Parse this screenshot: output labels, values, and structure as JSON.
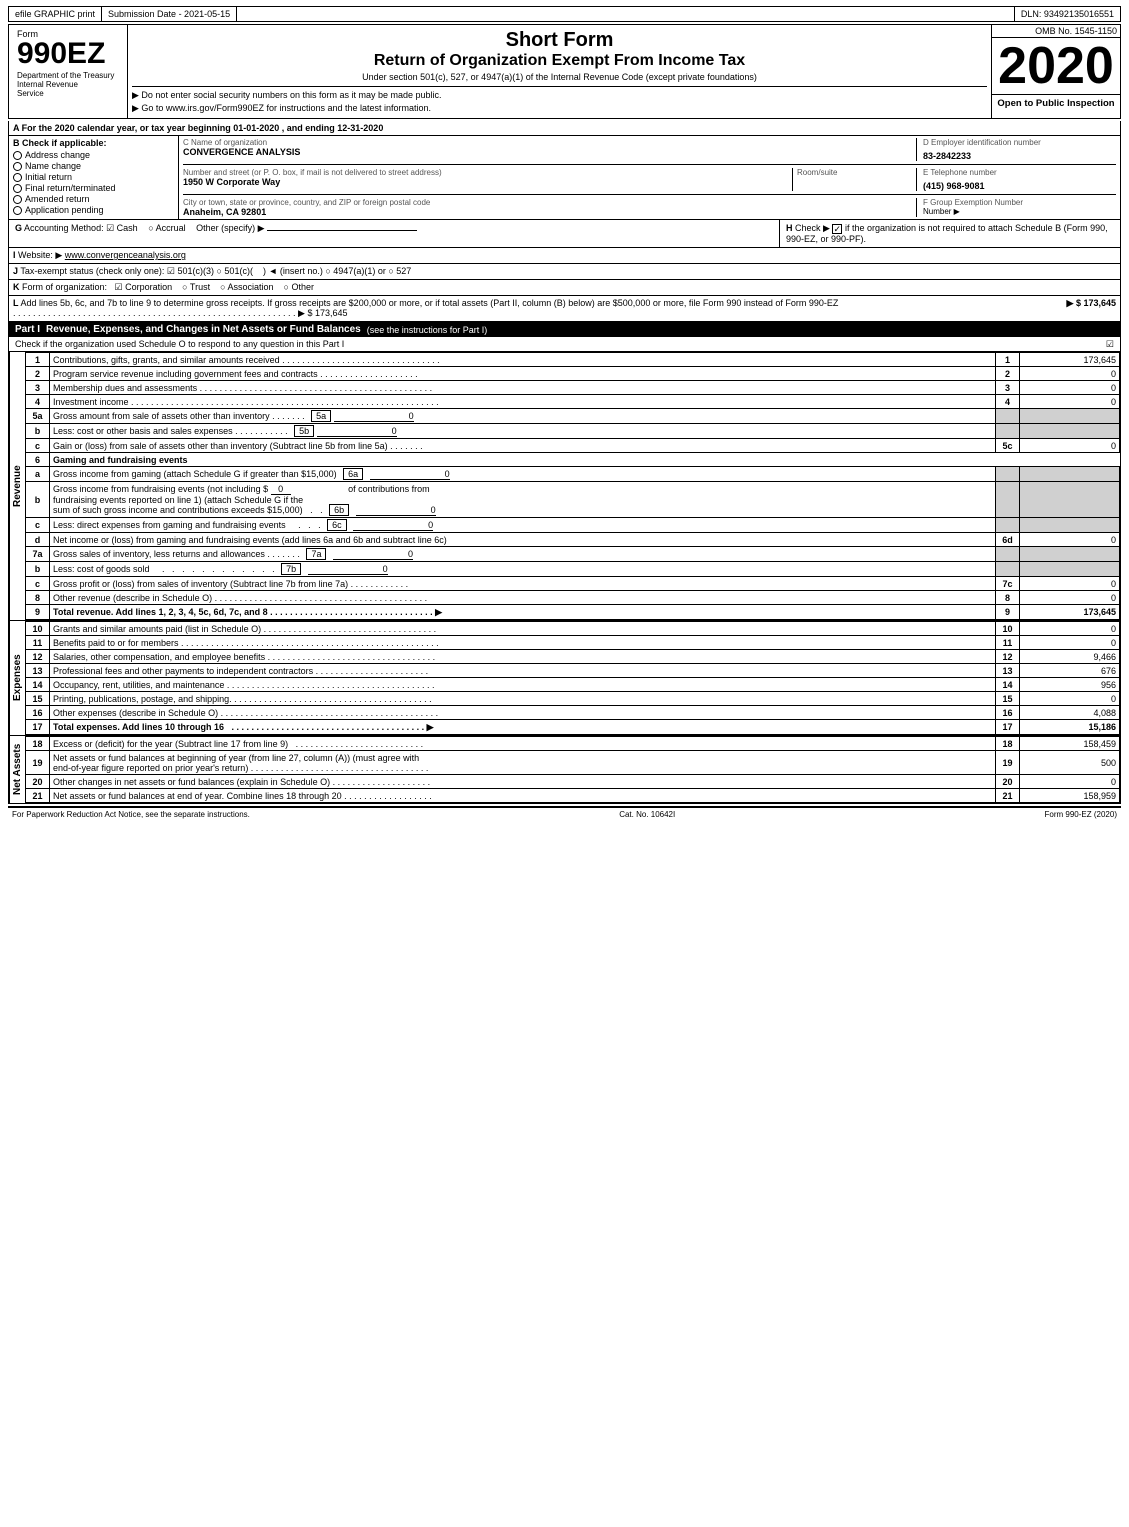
{
  "topbar": {
    "efile": "efile GRAPHIC print",
    "submission": "Submission Date - 2021-05-15",
    "dln": "DLN: 93492135016551"
  },
  "header": {
    "form_label": "Form",
    "form_number": "990EZ",
    "short_form": "Short Form",
    "return_title": "Return of Organization Exempt From Income Tax",
    "under_section": "Under section 501(c), 527, or 4947(a)(1) of the Internal Revenue Code (except private foundations)",
    "no_ssn": "▶ Do not enter social security numbers on this form as it may be made public.",
    "goto": "▶ Go to www.irs.gov/Form990EZ for instructions and the latest information.",
    "year": "2020",
    "open_public": "Open to Public Inspection",
    "omb": "OMB No. 1545-1150",
    "dept": "Department of the Treasury",
    "int_rev": "Internal Revenue",
    "service": "Service"
  },
  "section_a": {
    "text": "A  For the 2020 calendar year, or tax year beginning 01-01-2020 , and ending 12-31-2020"
  },
  "section_b": {
    "label": "B  Check if applicable:",
    "checkboxes": [
      {
        "label": "Address change",
        "checked": false
      },
      {
        "label": "Name change",
        "checked": false
      },
      {
        "label": "Initial return",
        "checked": false
      },
      {
        "label": "Final return/terminated",
        "checked": false
      },
      {
        "label": "Amended return",
        "checked": false
      },
      {
        "label": "Application pending",
        "checked": false
      }
    ],
    "c_label": "C Name of organization",
    "org_name": "CONVERGENCE ANALYSIS",
    "street_label": "Number and street (or P. O. box, if mail is not delivered to street address)",
    "street": "1950 W Corporate Way",
    "room_label": "Room/suite",
    "room": "",
    "city_label": "City or town, state or province, country, and ZIP or foreign postal code",
    "city": "Anaheim, CA  92801",
    "d_label": "D Employer identification number",
    "ein": "83-2842233",
    "e_label": "E Telephone number",
    "phone": "(415) 968-9081",
    "f_label": "F Group Exemption Number",
    "group_num": ""
  },
  "section_g": {
    "label": "G Accounting Method:",
    "cash_label": "☑ Cash",
    "cash_checked": true,
    "accrual_label": "○ Accrual",
    "other_label": "Other (specify) ▶",
    "h_label": "H  Check ▶",
    "h_checked": true,
    "h_text": "if the organization is not required to attach Schedule B (Form 990, 990-EZ, or 990-PF)."
  },
  "section_i": {
    "label": "I Website: ▶",
    "website": "www.convergenceanalysis.org"
  },
  "section_j": {
    "label": "J Tax-exempt status (check only one):",
    "options": [
      {
        "label": "501(c)(3)",
        "checked": true
      },
      {
        "label": "501(c)(",
        "checked": false
      },
      {
        "label": ") ◄ (insert no.)",
        "checked": false
      },
      {
        "label": "4947(a)(1) or",
        "checked": false
      },
      {
        "label": "527",
        "checked": false
      }
    ]
  },
  "section_k": {
    "label": "K Form of organization:",
    "options": [
      {
        "label": "Corporation",
        "checked": true
      },
      {
        "label": "Trust",
        "checked": false
      },
      {
        "label": "Association",
        "checked": false
      },
      {
        "label": "Other",
        "checked": false
      }
    ]
  },
  "section_l": {
    "text": "L Add lines 5b, 6c, and 7b to line 9 to determine gross receipts. If gross receipts are $200,000 or more, or if total assets (Part II, column (B) below) are $500,000 or more, file Form 990 instead of Form 990-EZ",
    "value": "▶ $ 173,645"
  },
  "part1": {
    "title": "Part I",
    "description": "Revenue, Expenses, and Changes in Net Assets or Fund Balances",
    "see_instructions": "(see the instructions for Part I)",
    "check_text": "Check if the organization used Schedule O to respond to any question in this Part I",
    "lines": [
      {
        "num": "1",
        "desc": "Contributions, gifts, grants, and similar amounts received",
        "dots": true,
        "ref": "1",
        "value": "173,645"
      },
      {
        "num": "2",
        "desc": "Program service revenue including government fees and contracts",
        "dots": true,
        "ref": "2",
        "value": "0"
      },
      {
        "num": "3",
        "desc": "Membership dues and assessments",
        "dots": true,
        "ref": "3",
        "value": "0"
      },
      {
        "num": "4",
        "desc": "Investment income",
        "dots": true,
        "ref": "4",
        "value": "0"
      },
      {
        "num": "5a",
        "desc": "Gross amount from sale of assets other than inventory",
        "dots": false,
        "ref": "5a",
        "value": "0",
        "inline_ref": true
      },
      {
        "num": "b",
        "desc": "Less: cost or other basis and sales expenses",
        "dots": false,
        "ref": "5b",
        "value": "0",
        "inline_ref": true
      },
      {
        "num": "c",
        "desc": "Gain or (loss) from sale of assets other than inventory (Subtract line 5b from line 5a)",
        "dots": true,
        "ref": "5c",
        "value": "0"
      },
      {
        "num": "6",
        "desc": "Gaming and fundraising events",
        "dots": false,
        "ref": "",
        "value": "",
        "header": true
      },
      {
        "num": "a",
        "desc": "Gross income from gaming (attach Schedule G if greater than $15,000)",
        "dots": false,
        "ref": "6a",
        "value": "0",
        "inline_ref": true
      },
      {
        "num": "b",
        "desc": "Gross income from fundraising events (not including $ 0 of contributions from fundraising events reported on line 1) (attach Schedule G if the sum of such gross income and contributions exceeds $15,000)",
        "dots": false,
        "ref": "6b",
        "value": "0",
        "inline_ref": true,
        "multiline": true
      },
      {
        "num": "c",
        "desc": "Less: direct expenses from gaming and fundraising events",
        "dots": false,
        "ref": "6c",
        "value": "0",
        "inline_ref": true
      },
      {
        "num": "d",
        "desc": "Net income or (loss) from gaming and fundraising events (add lines 6a and 6b and subtract line 6c)",
        "dots": false,
        "ref": "6d",
        "value": "0"
      },
      {
        "num": "7a",
        "desc": "Gross sales of inventory, less returns and allowances",
        "dots": false,
        "ref": "7a",
        "value": "0",
        "inline_ref": true
      },
      {
        "num": "b",
        "desc": "Less: cost of goods sold",
        "dots": false,
        "ref": "7b",
        "value": "0",
        "inline_ref": true
      },
      {
        "num": "c",
        "desc": "Gross profit or (loss) from sales of inventory (Subtract line 7b from line 7a)",
        "dots": true,
        "ref": "7c",
        "value": "0"
      },
      {
        "num": "8",
        "desc": "Other revenue (describe in Schedule O)",
        "dots": true,
        "ref": "8",
        "value": "0"
      },
      {
        "num": "9",
        "desc": "Total revenue. Add lines 1, 2, 3, 4, 5c, 6d, 7c, and 8",
        "dots": true,
        "ref": "9",
        "value": "173,645",
        "bold": true
      }
    ],
    "expenses_lines": [
      {
        "num": "10",
        "desc": "Grants and similar amounts paid (list in Schedule O)",
        "dots": true,
        "ref": "10",
        "value": "0"
      },
      {
        "num": "11",
        "desc": "Benefits paid to or for members",
        "dots": true,
        "ref": "11",
        "value": "0"
      },
      {
        "num": "12",
        "desc": "Salaries, other compensation, and employee benefits",
        "dots": true,
        "ref": "12",
        "value": "9,466"
      },
      {
        "num": "13",
        "desc": "Professional fees and other payments to independent contractors",
        "dots": true,
        "ref": "13",
        "value": "676"
      },
      {
        "num": "14",
        "desc": "Occupancy, rent, utilities, and maintenance",
        "dots": true,
        "ref": "14",
        "value": "956"
      },
      {
        "num": "15",
        "desc": "Printing, publications, postage, and shipping",
        "dots": true,
        "ref": "15",
        "value": "0"
      },
      {
        "num": "16",
        "desc": "Other expenses (describe in Schedule O)",
        "dots": true,
        "ref": "16",
        "value": "4,088"
      },
      {
        "num": "17",
        "desc": "Total expenses. Add lines 10 through 16",
        "dots": true,
        "ref": "17",
        "value": "15,186",
        "bold": true
      }
    ],
    "net_assets_lines": [
      {
        "num": "18",
        "desc": "Excess or (deficit) for the year (Subtract line 17 from line 9)",
        "dots": true,
        "ref": "18",
        "value": "158,459"
      },
      {
        "num": "19",
        "desc": "Net assets or fund balances at beginning of year (from line 27, column (A)) (must agree with end-of-year figure reported on prior year's return)",
        "dots": true,
        "ref": "19",
        "value": "500",
        "multiline": true
      },
      {
        "num": "20",
        "desc": "Other changes in net assets or fund balances (explain in Schedule O)",
        "dots": true,
        "ref": "20",
        "value": "0"
      },
      {
        "num": "21",
        "desc": "Net assets or fund balances at end of year. Combine lines 18 through 20",
        "dots": true,
        "ref": "21",
        "value": "158,959"
      }
    ]
  },
  "footer": {
    "paperwork": "For Paperwork Reduction Act Notice, see the separate instructions.",
    "cat": "Cat. No. 10642I",
    "form": "Form 990-EZ (2020)"
  }
}
